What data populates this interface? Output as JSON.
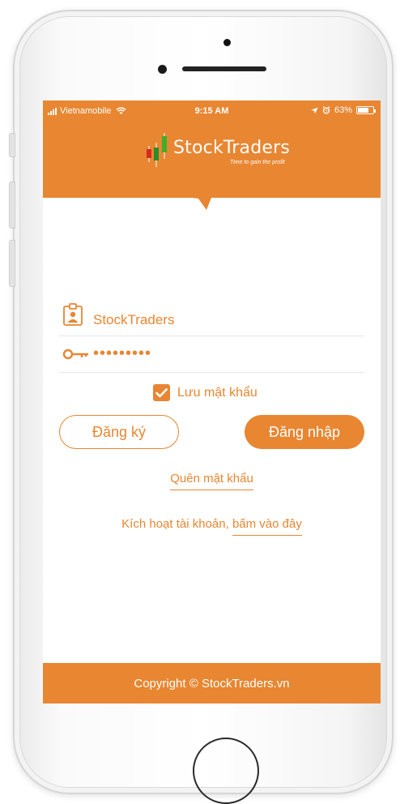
{
  "status_bar": {
    "carrier": "Vietnamobile",
    "time": "9:15 AM",
    "battery": "63%"
  },
  "brand": {
    "name": "StockTraders",
    "tagline": "Time to gain the profit",
    "accent_color": "#e88631"
  },
  "login_form": {
    "username_value": "StockTraders",
    "password_value": "•••••••••",
    "remember_label": "Lưu mật khẩu",
    "remember_checked": true,
    "register_label": "Đăng ký",
    "login_label": "Đăng nhập",
    "forgot_label": "Quên mật khẩu",
    "activate_text": "Kích hoạt tài khoản,",
    "activate_link": "bấm vào đây"
  },
  "footer": {
    "copyright": "Copyright © StockTraders.vn"
  },
  "icons": {
    "username": "id-badge-icon",
    "password": "key-icon",
    "checkbox": "checkmark-icon",
    "logo": "candlestick-icon"
  }
}
